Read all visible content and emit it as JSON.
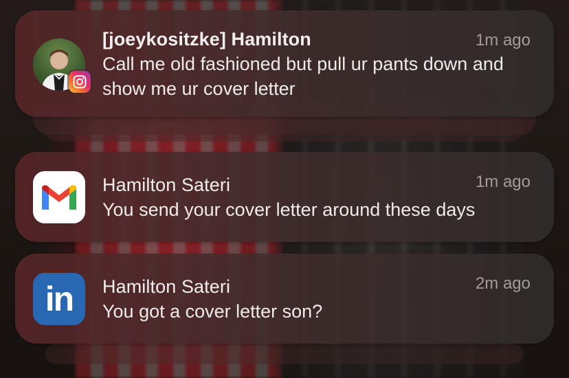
{
  "notifications": [
    {
      "app": "Instagram",
      "app_icon": "instagram-icon",
      "title": "[joeykositzke] Hamilton",
      "time": "1m ago",
      "body": "Call me old fashioned but pull ur pants down and show me ur cover letter"
    },
    {
      "app": "Gmail",
      "app_icon": "gmail-icon",
      "title": "Hamilton Sateri",
      "time": "1m ago",
      "body": "You send your cover letter around these days"
    },
    {
      "app": "LinkedIn",
      "app_icon": "linkedin-icon",
      "title": "Hamilton Sateri",
      "time": "2m ago",
      "body": "You got a cover letter son?"
    }
  ],
  "colors": {
    "gmail_red": "#EA4335",
    "gmail_blue": "#4285F4",
    "gmail_green": "#34A853",
    "gmail_yellow": "#FBBC05",
    "linkedin_blue": "#2867B2"
  }
}
